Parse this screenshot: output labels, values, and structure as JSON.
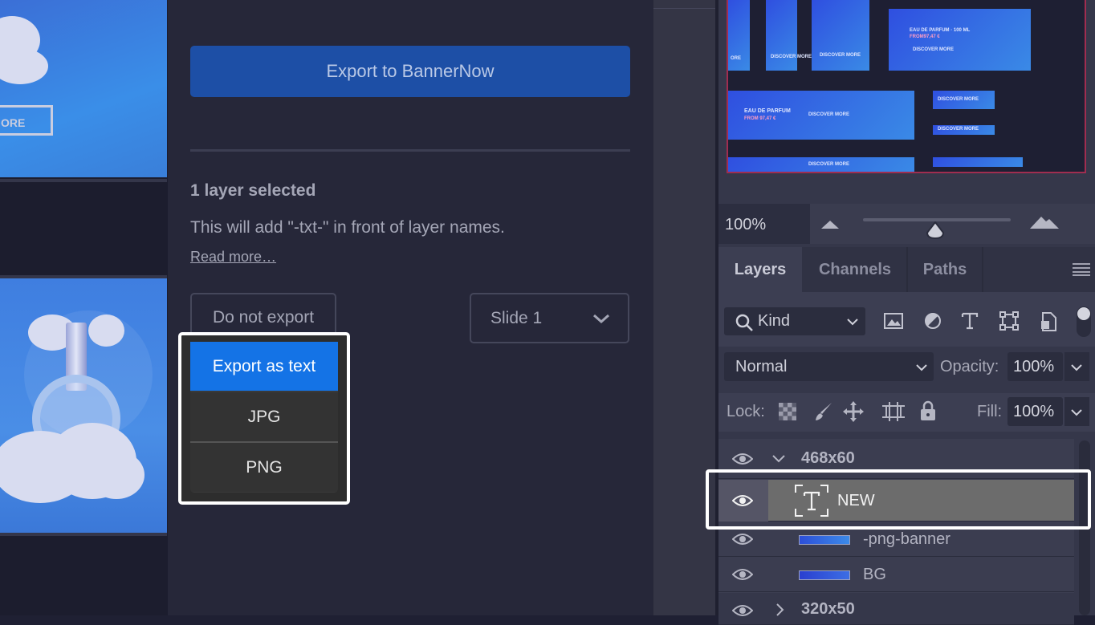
{
  "canvas": {
    "banner_button_label": "ORE"
  },
  "export_panel": {
    "export_button_label": "Export to BannerNow",
    "selection_heading": "1 layer selected",
    "description": "This will add \"-txt-\" in front of layer names.",
    "read_more_label": "Read more…",
    "export_type_dropdown": {
      "selected": "Do not export",
      "options": [
        "Export as text",
        "JPG",
        "PNG"
      ],
      "highlighted_option": "Export as text"
    },
    "slide_dropdown": {
      "selected": "Slide 1"
    }
  },
  "navigator": {
    "thumb_texts": {
      "eau_de_parfum_100": "EAU DE PARFUM · 100 ML",
      "from_price": "FROM97,47 €",
      "discover_more": "DISCOVER MORE",
      "eau_de_parfum": "EAU DE PARFUM",
      "from_short": "FROM 97,47 €"
    },
    "zoom_label": "100%"
  },
  "layers_panel": {
    "tabs": [
      "Layers",
      "Channels",
      "Paths"
    ],
    "active_tab": "Layers",
    "filter_kind_label": "Kind",
    "blend_mode": "Normal",
    "opacity_label": "Opacity:",
    "opacity_value": "100%",
    "lock_label": "Lock:",
    "fill_label": "Fill:",
    "fill_value": "100%",
    "layers": [
      {
        "name": "468x60",
        "type": "group",
        "expanded": true
      },
      {
        "name": "NEW",
        "type": "text",
        "selected": true
      },
      {
        "name": "-png-banner",
        "type": "image"
      },
      {
        "name": "BG",
        "type": "image"
      },
      {
        "name": "320x50",
        "type": "group",
        "expanded": false
      }
    ]
  },
  "colors": {
    "accent": "#1473e6",
    "export_button": "#1d4fa6",
    "selection_outline": "#ffffff"
  },
  "icons": [
    "chevron-down-icon",
    "search-icon",
    "image-filter-icon",
    "adjustment-filter-icon",
    "type-filter-icon",
    "shape-filter-icon",
    "smart-object-filter-icon",
    "eye-icon",
    "text-layer-icon",
    "lock-transparent-icon",
    "lock-paint-icon",
    "lock-move-icon",
    "lock-artboard-icon",
    "lock-all-icon",
    "panel-menu-icon",
    "zoom-out-mountain-icon",
    "zoom-in-mountain-icon"
  ]
}
